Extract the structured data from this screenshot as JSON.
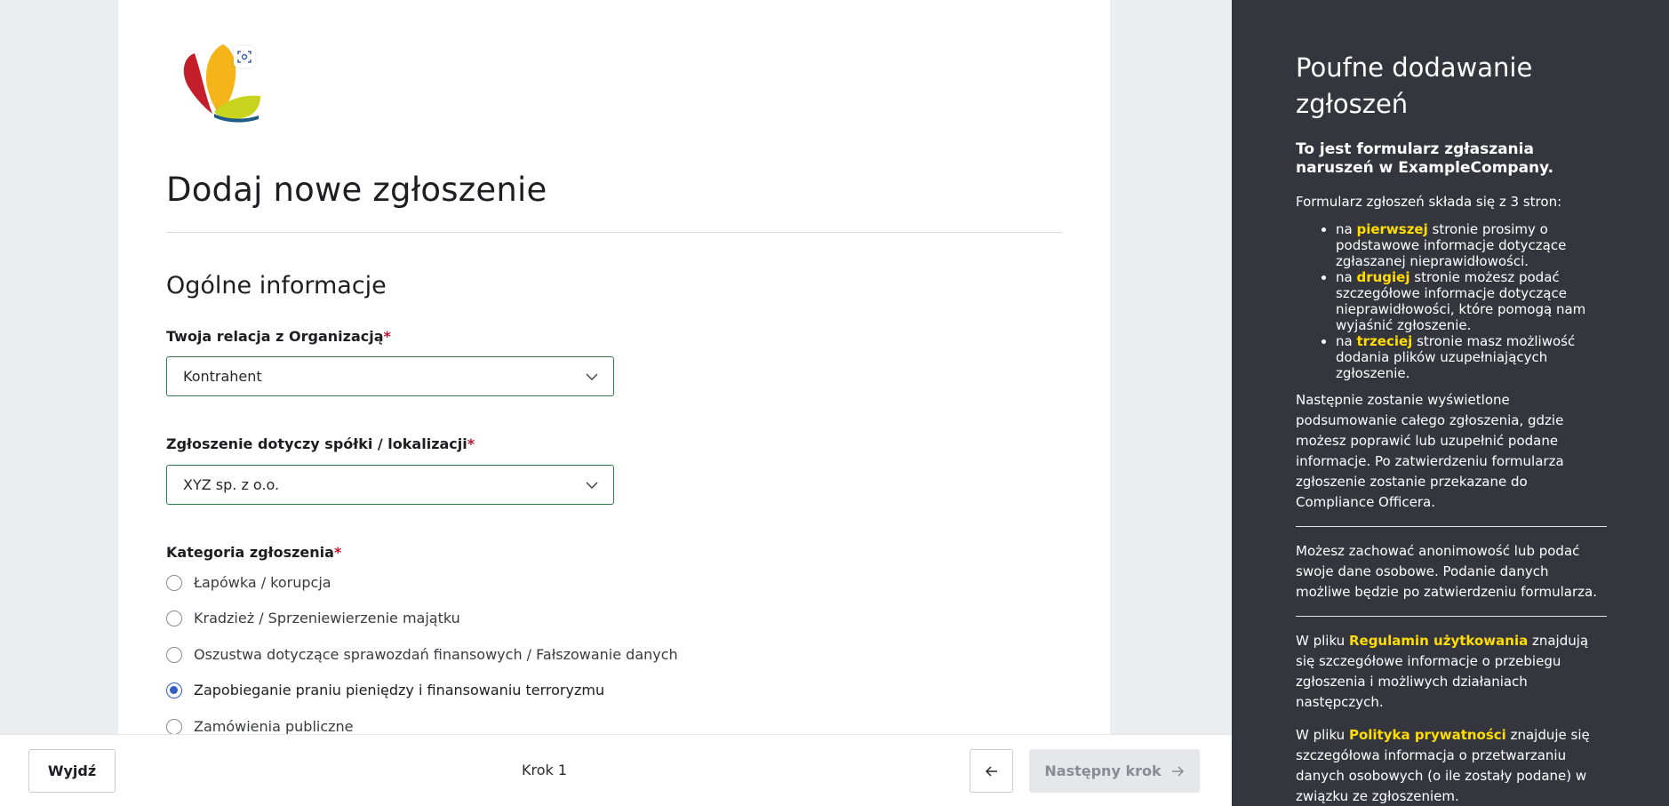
{
  "form": {
    "title": "Dodaj nowe zgłoszenie",
    "section_title": "Ogólne informacje",
    "relation": {
      "label": "Twoja relacja z Organizacją",
      "required_mark": "*",
      "value": "Kontrahent"
    },
    "company": {
      "label": "Zgłoszenie dotyczy spółki / lokalizacji",
      "required_mark": "*",
      "value": "XYZ sp. z o.o."
    },
    "category": {
      "label": "Kategoria zgłoszenia",
      "required_mark": "*",
      "options": [
        {
          "label": "Łapówka / korupcja",
          "selected": false
        },
        {
          "label": "Kradzież / Sprzeniewierzenie majątku",
          "selected": false
        },
        {
          "label": "Oszustwa dotyczące sprawozdań finansowych / Fałszowanie danych",
          "selected": false
        },
        {
          "label": "Zapobieganie praniu pieniędzy i finansowaniu terroryzmu",
          "selected": true
        },
        {
          "label": "Zamówienia publiczne",
          "selected": false
        }
      ]
    }
  },
  "footer": {
    "exit_label": "Wyjdź",
    "step_label": "Krok 1",
    "next_label": "Następny krok"
  },
  "side": {
    "title": "Poufne dodawanie zgłoszeń",
    "subtitle": "To jest formularz zgłaszania naruszeń w ExampleCompany.",
    "intro": "Formularz zgłoszeń składa się z 3 stron:",
    "steps": [
      {
        "pre": "na ",
        "hl": "pierwszej",
        "post": " stronie prosimy o podstawowe informacje dotyczące zgłaszanej nieprawidłowości."
      },
      {
        "pre": "na ",
        "hl": "drugiej",
        "post": " stronie możesz podać szczegółowe informacje dotyczące nieprawidłowości, które pomogą nam wyjaśnić zgłoszenie."
      },
      {
        "pre": "na ",
        "hl": "trzeciej",
        "post": " stronie masz możliwość dodania plików uzupełniających zgłoszenie."
      }
    ],
    "summary": "Następnie zostanie wyświetlone podsumowanie całego zgłoszenia, gdzie możesz poprawić lub uzupełnić podane informacje. Po zatwierdzeniu formularza zgłoszenie zostanie przekazane do Compliance Officera.",
    "anonymity": "Możesz zachować anonimowość lub podać swoje dane osobowe. Podanie danych możliwe będzie po zatwierdzeniu formularza.",
    "terms": {
      "pre": "W pliku ",
      "hl": "Regulamin użytkowania",
      "post": " znajdują się szczegółowe informacje o przebiegu zgłoszenia i możliwych działaniach następczych."
    },
    "privacy": {
      "pre": "W pliku ",
      "hl": "Polityka prywatności",
      "post": " znajduje się szczegółowa informacja o przetwarzaniu danych osobowych (o ile zostały podane) w związku ze zgłoszeniem."
    }
  },
  "icons": {
    "logo": "butterfly-logo",
    "scan": "scan-icon",
    "select_chevron": "chevron-down-icon",
    "back": "arrow-left-icon",
    "next": "arrow-right-icon"
  },
  "colors": {
    "accent_border": "#2e7d4f",
    "radio_selected": "#2f5fc4",
    "required": "#c0132e",
    "side_bg": "#35353d",
    "highlight": "#ffdd00"
  }
}
